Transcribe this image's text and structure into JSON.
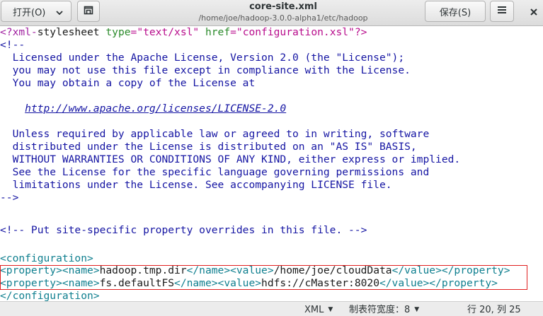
{
  "header": {
    "open_label": "打开(O)",
    "title": "core-site.xml",
    "subtitle": "/home/joe/hadoop-3.0.0-alpha1/etc/hadoop",
    "save_label": "保存(S)"
  },
  "editor": {
    "line1": {
      "a": "<?xml-",
      "b": "stylesheet ",
      "c": "type",
      "d": "=\"text/xsl\" ",
      "e": "href",
      "f": "=\"configuration.xsl\"?>"
    },
    "comment_open": "<!--",
    "license": [
      "  Licensed under the Apache License, Version 2.0 (the \"License\");",
      "  you may not use this file except in compliance with the License.",
      "  You may obtain a copy of the License at",
      "",
      "    http://www.apache.org/licenses/LICENSE-2.0",
      "",
      "  Unless required by applicable law or agreed to in writing, software",
      "  distributed under the License is distributed on an \"AS IS\" BASIS,",
      "  WITHOUT WARRANTIES OR CONDITIONS OF ANY KIND, either express or implied.",
      "  See the License for the specific language governing permissions and",
      "  limitations under the License. See accompanying LICENSE file."
    ],
    "license_indent": "    ",
    "license_url": "http://www.apache.org/licenses/LICENSE-2.0",
    "comment_close": "-->",
    "site_comment": "<!-- Put site-specific property overrides in this file. -->",
    "config_open": "<configuration>",
    "property1": {
      "open": "<property><name>",
      "name": "hadoop.tmp.dir",
      "mid": "</name><value>",
      "value": "/home/joe/cloudData",
      "close": "</value></property>"
    },
    "property2": {
      "open": "<property><name>",
      "name": "fs.defaultFS",
      "mid": "</name><value>",
      "value": "hdfs://cMaster:8020",
      "close": "</value></property>"
    },
    "config_close": "</configuration>"
  },
  "status": {
    "language": "XML",
    "tab_width": "制表符宽度：8",
    "position": "行 20, 列 25"
  },
  "colors": {
    "comment": "#1515a3",
    "tag": "#0f7f8f",
    "highlight_border": "#e02020"
  }
}
